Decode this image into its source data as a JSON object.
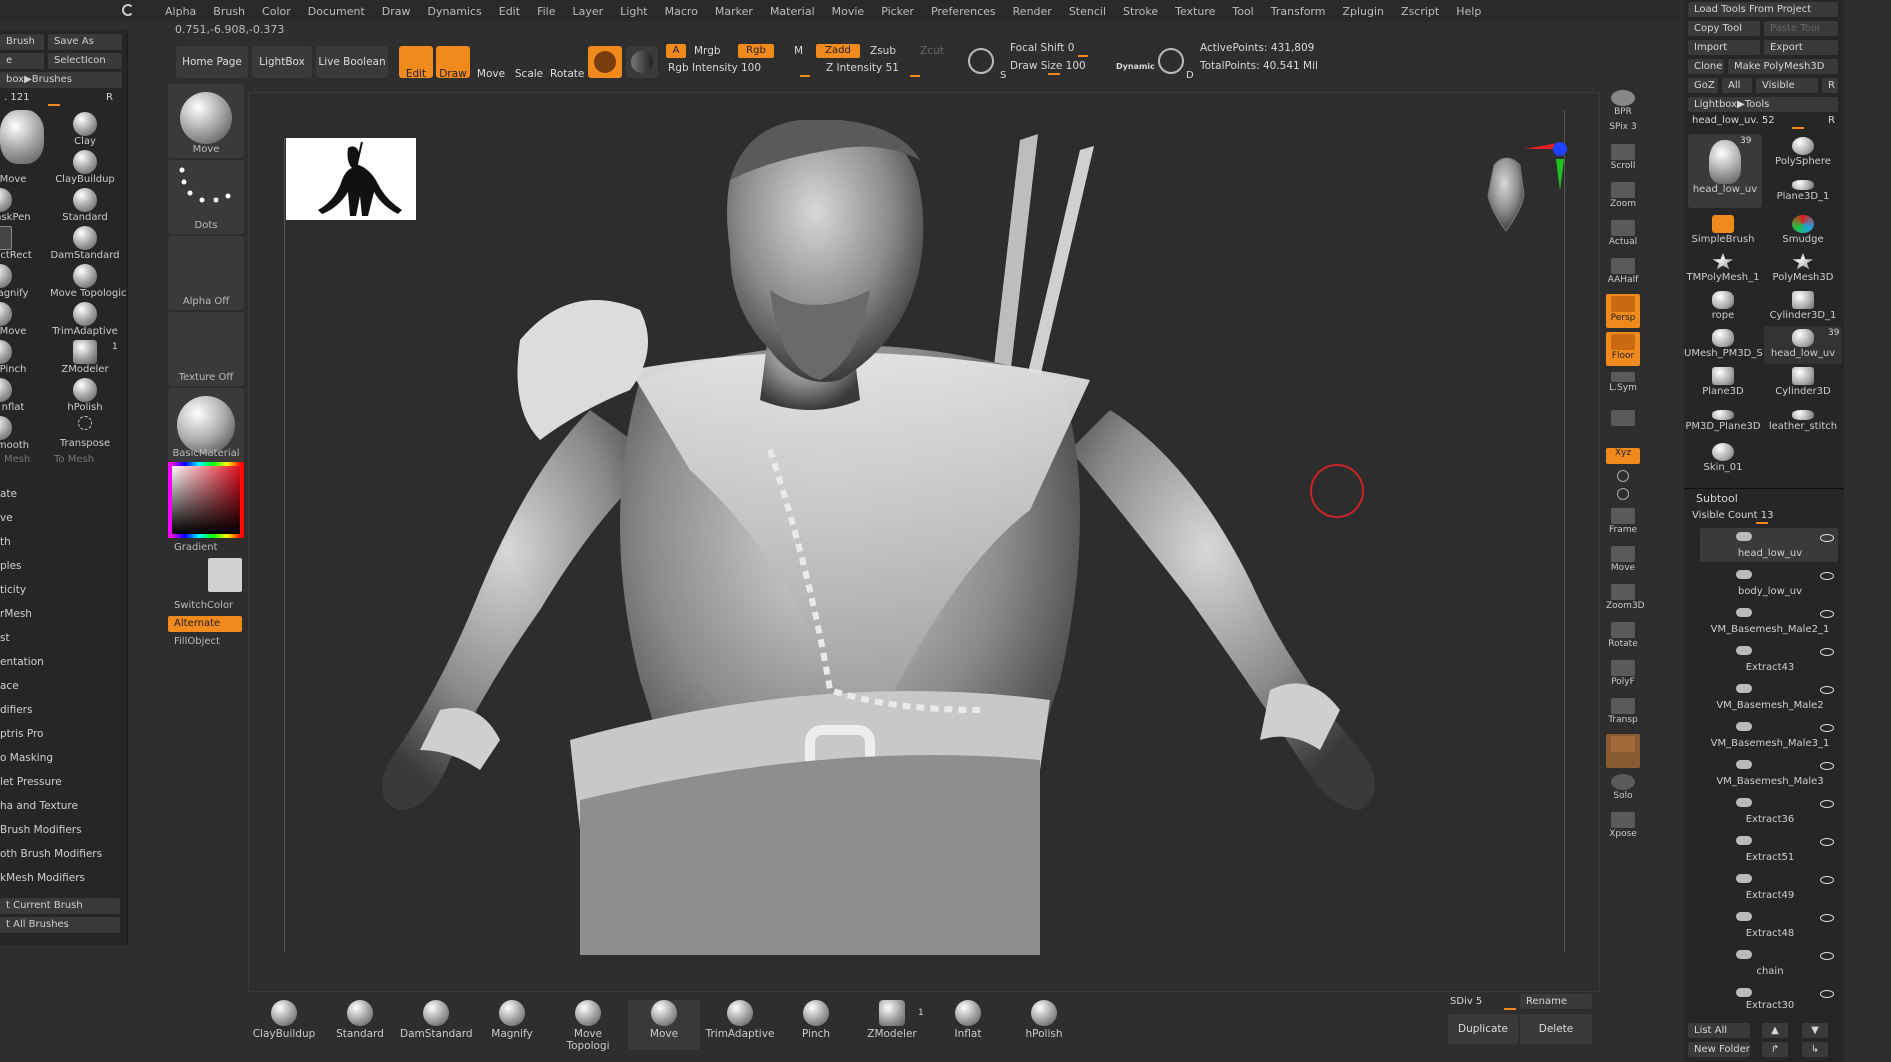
{
  "menu": [
    "Alpha",
    "Brush",
    "Color",
    "Document",
    "Draw",
    "Dynamics",
    "Edit",
    "File",
    "Layer",
    "Light",
    "Macro",
    "Marker",
    "Material",
    "Movie",
    "Picker",
    "Preferences",
    "Render",
    "Stencil",
    "Stroke",
    "Texture",
    "Tool",
    "Transform",
    "Zplugin",
    "Zscript",
    "Help"
  ],
  "coords": "0.751,-6.908,-0.373",
  "left_panel": {
    "top_buttons": [
      "Brush",
      "Save As",
      "e",
      "SelectIcon"
    ],
    "lightbox_brushes": "box▶Brushes",
    "size_value": ". 121",
    "size_r": "R",
    "brushes": [
      {
        "label": "Move",
        "badge": ""
      },
      {
        "label": "Clay",
        "badge": ""
      },
      {
        "label": "",
        "badge": ""
      },
      {
        "label": "ClayBuildup",
        "badge": ""
      },
      {
        "label": "askPen",
        "badge": ""
      },
      {
        "label": "Standard",
        "badge": ""
      },
      {
        "label": "ectRect",
        "badge": ""
      },
      {
        "label": "DamStandard",
        "badge": ""
      },
      {
        "label": "agnify",
        "badge": ""
      },
      {
        "label": "Move Topologic",
        "badge": ""
      },
      {
        "label": "Move",
        "badge": ""
      },
      {
        "label": "TrimAdaptive",
        "badge": ""
      },
      {
        "label": "Pinch",
        "badge": ""
      },
      {
        "label": "ZModeler",
        "badge": "1"
      },
      {
        "label": "nflat",
        "badge": ""
      },
      {
        "label": "hPolish",
        "badge": ""
      },
      {
        "label": "mooth",
        "badge": ""
      },
      {
        "label": "Transpose",
        "badge": ""
      }
    ],
    "mesh_labels": [
      "Mesh",
      "To Mesh"
    ],
    "list": [
      "ate",
      "ve",
      "th",
      "ples",
      "ticity",
      "rMesh",
      "st",
      "entation",
      "ace",
      "difiers",
      "ptris Pro",
      "o Masking",
      "let Pressure",
      "ha and Texture",
      "Brush Modifiers",
      "oth Brush Modifiers",
      "kMesh Modifiers"
    ],
    "bottom_buttons": [
      "t Current Brush",
      "t All Brushes"
    ]
  },
  "material_column": {
    "items": [
      "Move",
      "Dots",
      "Alpha Off",
      "Texture Off",
      "BasicMaterial"
    ],
    "gradient": "Gradient",
    "switch_color": "SwitchColor",
    "alternate": "Alternate",
    "fill_object": "FillObject"
  },
  "toolbar": {
    "home_page": "Home Page",
    "lightbox": "LightBox",
    "live_boolean": "Live Boolean",
    "edit": "Edit",
    "draw": "Draw",
    "move": "Move",
    "scale": "Scale",
    "rotate": "Rotate",
    "a_label": "A",
    "mrgb": "Mrgb",
    "rgb": "Rgb",
    "m": "M",
    "zadd": "Zadd",
    "zsub": "Zsub",
    "zcut": "Zcut",
    "rgb_intensity": "Rgb Intensity 100",
    "z_intensity": "Z Intensity 51",
    "focal_shift": "Focal Shift 0",
    "draw_size": "Draw Size 100",
    "dynamic": "Dynamic",
    "active_points": "ActivePoints: 431,809",
    "total_points": "TotalPoints: 40.541 Mil",
    "s_label": "S",
    "d_label": "D"
  },
  "right_shelf": [
    "BPR",
    "SPix 3",
    "Scroll",
    "Zoom",
    "Actual",
    "AAHalf",
    "Persp",
    "Floor",
    "L.Sym",
    "",
    "Xyz",
    "",
    "",
    "Frame",
    "Move",
    "Zoom3D",
    "Rotate",
    "PolyF",
    "Transp",
    "Ghost",
    "Solo",
    "Xpose"
  ],
  "right_panel": {
    "load_tools": "Load Tools From Project",
    "copy_tool": "Copy Tool",
    "paste_tool": "Paste Tool",
    "import": "Import",
    "export": "Export",
    "clone": "Clone",
    "make_polymesh": "Make PolyMesh3D",
    "goz": "GoZ",
    "all": "All",
    "visible": "Visible",
    "r": "R",
    "lightbox_tools": "Lightbox▶Tools",
    "current_tool": "head_low_uv. 52",
    "tools": [
      {
        "label": "head_low_uv",
        "badge": "39"
      },
      {
        "label": "PolySphere",
        "badge": ""
      },
      {
        "label": "",
        "badge": ""
      },
      {
        "label": "Plane3D_1",
        "badge": ""
      },
      {
        "label": "SimpleBrush",
        "badge": ""
      },
      {
        "label": "Smudge",
        "badge": ""
      },
      {
        "label": "TMPolyMesh_1",
        "badge": ""
      },
      {
        "label": "PolyMesh3D",
        "badge": ""
      },
      {
        "label": "rope",
        "badge": ""
      },
      {
        "label": "Cylinder3D_1",
        "badge": ""
      },
      {
        "label": "UMesh_PM3D_S",
        "badge": ""
      },
      {
        "label": "head_low_uv",
        "badge": "39"
      },
      {
        "label": "Plane3D",
        "badge": ""
      },
      {
        "label": "Cylinder3D",
        "badge": ""
      },
      {
        "label": "PM3D_Plane3D",
        "badge": ""
      },
      {
        "label": "leather_stitch",
        "badge": ""
      },
      {
        "label": "Skin_01",
        "badge": ""
      }
    ],
    "subtool_title": "Subtool",
    "visible_count": "Visible Count 13",
    "subtools": [
      "head_low_uv",
      "body_low_uv",
      "VM_Basemesh_Male2_1",
      "Extract43",
      "VM_Basemesh_Male2",
      "VM_Basemesh_Male3_1",
      "VM_Basemesh_Male3",
      "Extract36",
      "Extract51",
      "Extract49",
      "Extract48",
      "chain",
      "Extract30"
    ],
    "list_all": "List All",
    "new_folder": "New Folder"
  },
  "bottom_brushes": [
    {
      "label": "ClayBuildup",
      "badge": ""
    },
    {
      "label": "Standard",
      "badge": ""
    },
    {
      "label": "DamStandard",
      "badge": ""
    },
    {
      "label": "Magnify",
      "badge": ""
    },
    {
      "label": "Move Topologi",
      "badge": ""
    },
    {
      "label": "Move",
      "badge": ""
    },
    {
      "label": "TrimAdaptive",
      "badge": ""
    },
    {
      "label": "Pinch",
      "badge": ""
    },
    {
      "label": "ZModeler",
      "badge": "1"
    },
    {
      "label": "Inflat",
      "badge": ""
    },
    {
      "label": "hPolish",
      "badge": ""
    }
  ],
  "bottom_right": {
    "sdiv": "SDiv 5",
    "rename": "Rename",
    "duplicate": "Duplicate",
    "delete": "Delete"
  },
  "colors": {
    "accent": "#f08a1c",
    "panel": "#262626",
    "viewport": "#2d2d2d"
  }
}
